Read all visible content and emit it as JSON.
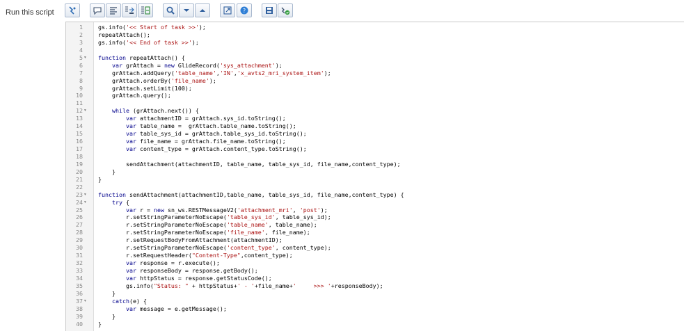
{
  "page": {
    "label": "Run this script"
  },
  "toolbar": {
    "buttons": [
      {
        "icon": "format-code-icon"
      },
      {
        "icon": "comment-icon"
      },
      {
        "icon": "align-left-icon"
      },
      {
        "icon": "replace-icon"
      },
      {
        "icon": "replace-all-icon"
      },
      {
        "icon": "search-icon"
      },
      {
        "icon": "chevron-down-icon"
      },
      {
        "icon": "chevron-up-icon"
      },
      {
        "icon": "expand-window-icon"
      },
      {
        "icon": "help-icon"
      },
      {
        "icon": "save-icon"
      },
      {
        "icon": "check-script-icon"
      }
    ]
  },
  "editor": {
    "fold_marker": "▾",
    "folds": [
      5,
      12,
      23,
      24,
      37
    ],
    "lines": [
      "gs.info('<< Start of task >>');",
      "repeatAttach();",
      "gs.info('<< End of task >>');",
      "",
      "function repeatAttach() {",
      "    var grAttach = new GlideRecord('sys_attachment');",
      "    grAttach.addQuery('table_name','IN','x_avts2_mri_system_item');",
      "    grAttach.orderBy('file_name');",
      "    grAttach.setLimit(100);",
      "    grAttach.query();",
      "",
      "    while (grAttach.next()) {",
      "        var attachmentID = grAttach.sys_id.toString();",
      "        var table_name =  grAttach.table_name.toString();",
      "        var table_sys_id = grAttach.table_sys_id.toString();",
      "        var file_name = grAttach.file_name.toString();",
      "        var content_type = grAttach.content_type.toString();",
      "",
      "        sendAttachment(attachmentID, table_name, table_sys_id, file_name,content_type);",
      "    }",
      "}",
      "",
      "function sendAttachment(attachmentID,table_name, table_sys_id, file_name,content_type) {",
      "    try {",
      "        var r = new sn_ws.RESTMessageV2('attachment_mri', 'post');",
      "        r.setStringParameterNoEscape('table_sys_id', table_sys_id);",
      "        r.setStringParameterNoEscape('table_name', table_name);",
      "        r.setStringParameterNoEscape('file_name', file_name);",
      "        r.setRequestBodyFromAttachment(attachmentID);",
      "        r.setStringParameterNoEscape('content_type', content_type);",
      "        r.setRequestHeader(\"Content-Type\",content_type);",
      "        var response = r.execute();",
      "        var responseBody = response.getBody();",
      "        var httpStatus = response.getStatusCode();",
      "        gs.info(\"Status: \" + httpStatus+' - '+file_name+'     >>> '+responseBody);",
      "    }",
      "    catch(e) {",
      "        var message = e.getMessage();",
      "    }",
      "}"
    ]
  }
}
